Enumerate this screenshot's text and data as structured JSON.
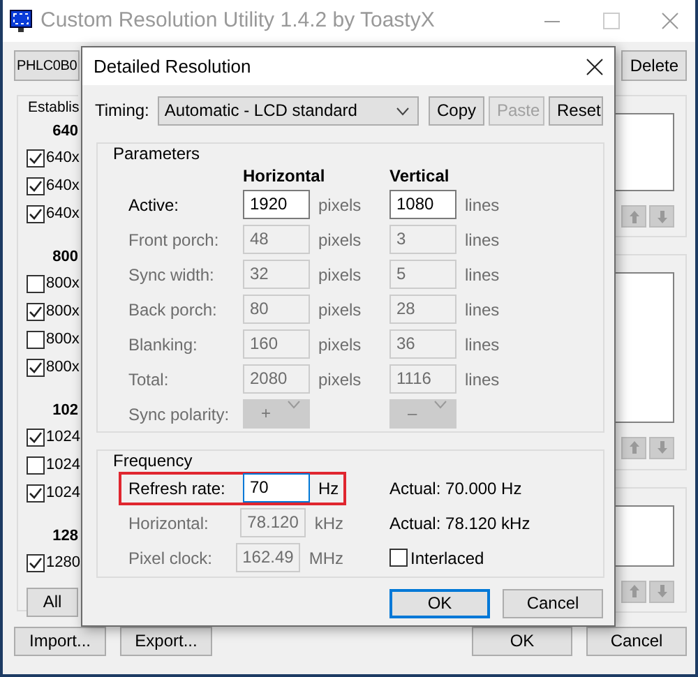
{
  "main_window": {
    "title": "Custom Resolution Utility 1.4.2 by ToastyX",
    "device_button": "PHLC0B0",
    "delete_button": "Delete",
    "established_group": {
      "title": "Establis",
      "groups": [
        {
          "heading": "640",
          "items": [
            {
              "label": "640x",
              "checked": true
            },
            {
              "label": "640x",
              "checked": true
            },
            {
              "label": "640x",
              "checked": true
            }
          ]
        },
        {
          "heading": "800",
          "items": [
            {
              "label": "800x",
              "checked": false
            },
            {
              "label": "800x",
              "checked": true
            },
            {
              "label": "800x",
              "checked": false
            },
            {
              "label": "800x",
              "checked": true
            }
          ]
        },
        {
          "heading": "102",
          "items": [
            {
              "label": "1024",
              "checked": true
            },
            {
              "label": "1024",
              "checked": false
            },
            {
              "label": "1024",
              "checked": true
            }
          ]
        },
        {
          "heading": "128",
          "items": [
            {
              "label": "1280",
              "checked": true
            }
          ]
        }
      ],
      "all_button": "All"
    },
    "import_button": "Import...",
    "export_button": "Export...",
    "ok_button": "OK",
    "cancel_button": "Cancel"
  },
  "dialog": {
    "title": "Detailed Resolution",
    "timing_label": "Timing:",
    "timing_value": "Automatic - LCD standard",
    "buttons": [
      {
        "label": "Copy",
        "disabled": false
      },
      {
        "label": "Paste",
        "disabled": true
      },
      {
        "label": "Reset",
        "disabled": false
      }
    ],
    "parameters": {
      "title": "Parameters",
      "column_headers": [
        "Horizontal",
        "Vertical"
      ],
      "rows": [
        {
          "label": "Active:",
          "kind": "field",
          "disabled": false,
          "horizontal": "1920",
          "horizontal_unit": "pixels",
          "vertical": "1080",
          "vertical_unit": "lines"
        },
        {
          "label": "Front porch:",
          "kind": "field",
          "disabled": true,
          "horizontal": "48",
          "horizontal_unit": "pixels",
          "vertical": "3",
          "vertical_unit": "lines"
        },
        {
          "label": "Sync width:",
          "kind": "field",
          "disabled": true,
          "horizontal": "32",
          "horizontal_unit": "pixels",
          "vertical": "5",
          "vertical_unit": "lines"
        },
        {
          "label": "Back porch:",
          "kind": "field",
          "disabled": true,
          "horizontal": "80",
          "horizontal_unit": "pixels",
          "vertical": "28",
          "vertical_unit": "lines"
        },
        {
          "label": "Blanking:",
          "kind": "field",
          "disabled": true,
          "horizontal": "160",
          "horizontal_unit": "pixels",
          "vertical": "36",
          "vertical_unit": "lines"
        },
        {
          "label": "Total:",
          "kind": "field",
          "disabled": true,
          "horizontal": "2080",
          "horizontal_unit": "pixels",
          "vertical": "1116",
          "vertical_unit": "lines"
        },
        {
          "label": "Sync polarity:",
          "kind": "select",
          "disabled": true,
          "horizontal": "+",
          "vertical": "–"
        }
      ]
    },
    "frequency": {
      "title": "Frequency",
      "rows": [
        {
          "label": "Refresh rate:",
          "value": "70",
          "unit": "Hz",
          "disabled": false,
          "highlighted": true,
          "extra": {
            "kind": "text",
            "text": "Actual: 70.000 Hz"
          }
        },
        {
          "label": "Horizontal:",
          "value": "78.120",
          "unit": "kHz",
          "disabled": true,
          "highlighted": false,
          "extra": {
            "kind": "text",
            "text": "Actual: 78.120 kHz"
          }
        },
        {
          "label": "Pixel clock:",
          "value": "162.49",
          "unit": "MHz",
          "disabled": true,
          "highlighted": false,
          "extra": {
            "kind": "checkbox",
            "label": "Interlaced",
            "checked": false
          }
        }
      ]
    },
    "ok_button": "OK",
    "cancel_button": "Cancel"
  }
}
